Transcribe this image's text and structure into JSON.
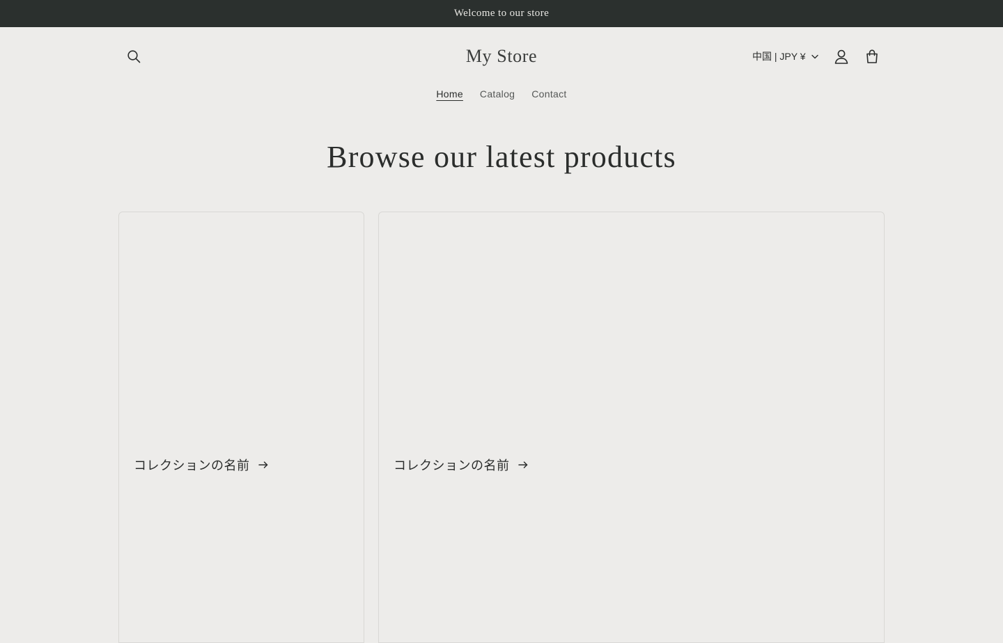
{
  "announcement": {
    "text": "Welcome to our store"
  },
  "header": {
    "logo": "My Store",
    "locale": "中国 | JPY ¥",
    "icons": {
      "search": "search-icon",
      "account": "account-icon",
      "cart": "cart-icon",
      "locale": "chevron-down-icon"
    }
  },
  "nav": {
    "items": [
      {
        "label": "Home",
        "active": true
      },
      {
        "label": "Catalog",
        "active": false
      },
      {
        "label": "Contact",
        "active": false
      }
    ]
  },
  "main": {
    "heading": "Browse our latest products",
    "collections": [
      {
        "title": "コレクションの名前"
      },
      {
        "title": "コレクションの名前"
      }
    ]
  },
  "colors": {
    "announcement_bg": "#2b302e",
    "page_bg": "#edecea",
    "text": "#2b2d2c"
  }
}
